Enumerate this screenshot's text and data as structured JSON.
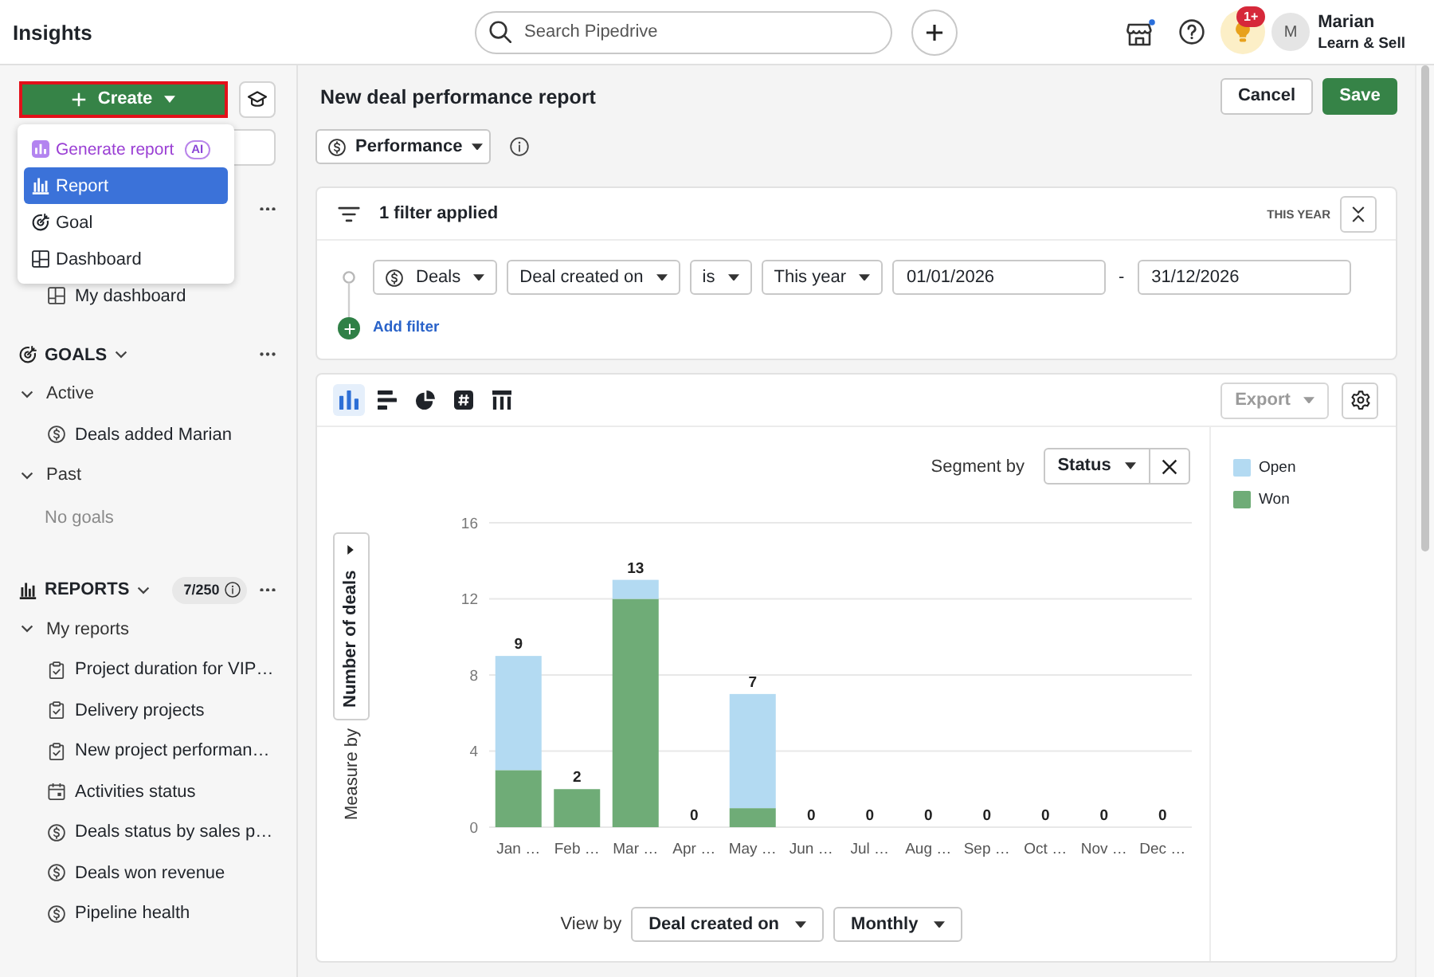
{
  "top_bar": {
    "title": "Insights",
    "search": {
      "placeholder": "Search Pipedrive"
    },
    "tips": {
      "badge": "1+"
    },
    "user": {
      "initial": "M",
      "name": "Marian",
      "company": "Learn & Sell"
    }
  },
  "sidebar": {
    "create_button": {
      "label": "Create"
    },
    "create_menu": [
      {
        "kind": "ai",
        "label": "Generate report",
        "badge": "AI",
        "selected": false
      },
      {
        "kind": "report",
        "label": "Report",
        "selected": true
      },
      {
        "kind": "goal",
        "label": "Goal",
        "selected": false
      },
      {
        "kind": "dashboard",
        "label": "Dashboard",
        "selected": false
      }
    ],
    "dashboards": {
      "items": [
        {
          "kind": "dashboard",
          "label": "My dashboard"
        }
      ]
    },
    "goals": {
      "title": "GOALS",
      "expanded": true,
      "groups": [
        {
          "label": "Active",
          "expanded": true,
          "items": [
            {
              "kind": "deal",
              "label": "Deals added Marian"
            }
          ]
        },
        {
          "label": "Past",
          "expanded": true,
          "empty_text": "No goals"
        }
      ]
    },
    "reports": {
      "title": "REPORTS",
      "expanded": true,
      "count": "7/250",
      "groups": [
        {
          "label": "My reports",
          "expanded": true,
          "items": [
            {
              "kind": "project",
              "label": "Project duration for VIP…"
            },
            {
              "kind": "project",
              "label": "Delivery projects"
            },
            {
              "kind": "project",
              "label": "New project performan…"
            },
            {
              "kind": "activity",
              "label": "Activities status"
            },
            {
              "kind": "deal",
              "label": "Deals status by sales p…"
            },
            {
              "kind": "deal",
              "label": "Deals won revenue"
            },
            {
              "kind": "deal",
              "label": "Pipeline health"
            }
          ]
        }
      ]
    }
  },
  "report": {
    "title": "New deal performance report",
    "actions": [
      {
        "kind": "cancel",
        "label": "Cancel"
      },
      {
        "kind": "save",
        "label": "Save"
      }
    ],
    "report_type": {
      "value": "Performance"
    },
    "filters": {
      "summary": "1 filter applied",
      "period": "THIS YEAR",
      "conditions": [
        {
          "kind": "entity",
          "value": "Deals"
        },
        {
          "kind": "select",
          "value": "Deal created on"
        },
        {
          "kind": "select",
          "value": "is"
        },
        {
          "kind": "select",
          "value": "This year"
        },
        {
          "kind": "date",
          "value": "01/01/2026"
        },
        {
          "kind": "separator",
          "text": "-"
        },
        {
          "kind": "date",
          "value": "31/12/2026"
        }
      ],
      "add_label": "Add filter"
    },
    "chart_panel": {
      "chart_types": [
        {
          "kind": "column",
          "selected": true
        },
        {
          "kind": "bar",
          "selected": false
        },
        {
          "kind": "pie",
          "selected": false
        },
        {
          "kind": "number",
          "selected": false
        },
        {
          "kind": "table",
          "selected": false
        }
      ],
      "export_button": {
        "label": "Export",
        "disabled": true
      },
      "segment_by": {
        "label": "Segment by",
        "value": "Status"
      },
      "measure_by": {
        "value": "Number of deals",
        "label": "Measure by"
      },
      "chart_data": {
        "type": "bar",
        "stacked": true,
        "grid": true,
        "categories": [
          "Jan …",
          "Feb …",
          "Mar …",
          "Apr …",
          "May …",
          "Jun …",
          "Jul …",
          "Aug …",
          "Sep …",
          "Oct …",
          "Nov …",
          "Dec …"
        ],
        "series": [
          {
            "name": "Open",
            "color": "#b3daf2",
            "values": [
              6,
              0,
              1,
              0,
              6,
              0,
              0,
              0,
              0,
              0,
              0,
              0
            ]
          },
          {
            "name": "Won",
            "color": "#6fac77",
            "values": [
              3,
              2,
              12,
              0,
              1,
              0,
              0,
              0,
              0,
              0,
              0,
              0
            ]
          }
        ],
        "ylim": [
          0,
          16
        ],
        "yticks": [
          0,
          4,
          8,
          12,
          16
        ],
        "value_labels": [
          "9",
          "2",
          "13",
          "0",
          "7",
          "0",
          "0",
          "0",
          "0",
          "0",
          "0",
          "0"
        ]
      },
      "view_by": {
        "label": "View by",
        "field": "Deal created on",
        "interval": "Monthly"
      }
    }
  }
}
